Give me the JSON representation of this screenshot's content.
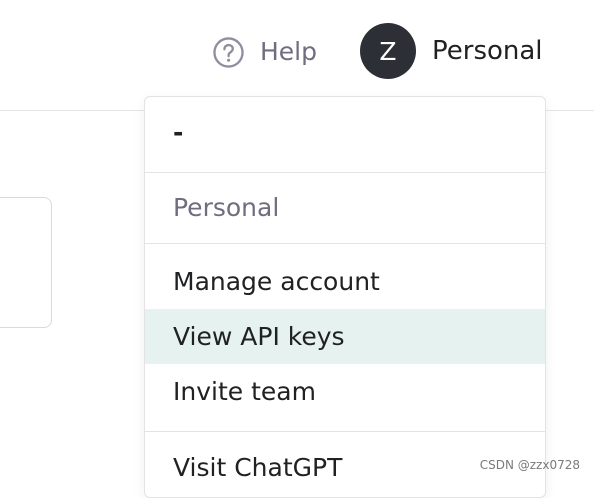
{
  "header": {
    "help_label": "Help",
    "help_icon": "question-circle-icon",
    "avatar_initial": "Z",
    "account_label": "Personal"
  },
  "dropdown": {
    "user_name": "-",
    "org_name": "Personal",
    "links": [
      {
        "label": "Manage account",
        "active": false
      },
      {
        "label": "View API keys",
        "active": true
      },
      {
        "label": "Invite team",
        "active": false
      }
    ],
    "visit_label": "Visit ChatGPT"
  },
  "colors": {
    "avatar_bg": "#2d2f36",
    "active_item_bg": "#e6f2f0",
    "muted_text": "#6e6e80",
    "primary_text": "#202123"
  },
  "watermark": "CSDN @zzx0728"
}
